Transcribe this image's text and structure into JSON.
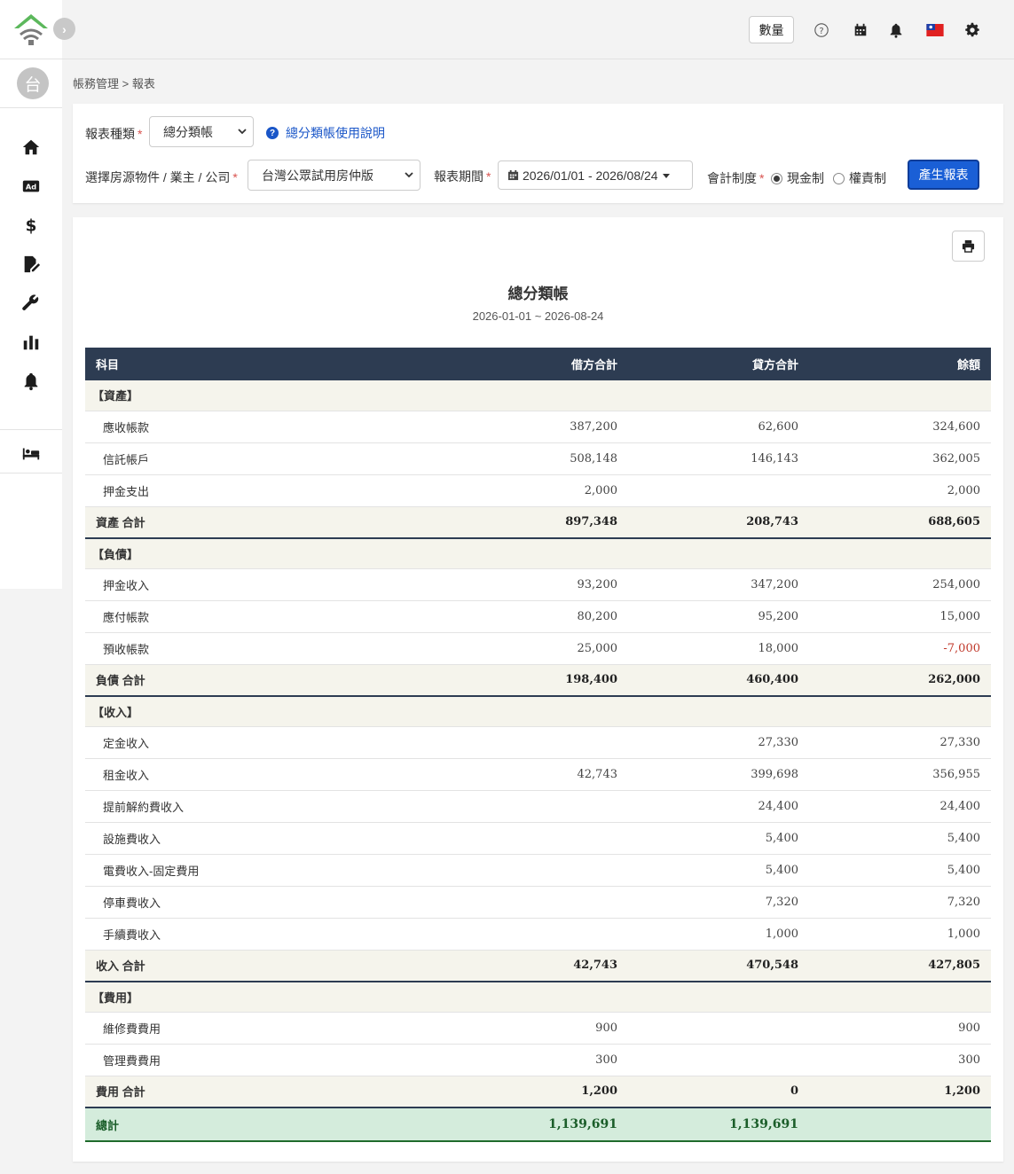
{
  "sidebar": {
    "avatar_text": "台"
  },
  "topbar": {
    "qty_label": "數量"
  },
  "breadcrumb": "帳務管理 > 報表",
  "filter": {
    "report_type_label": "報表種類",
    "report_type_value": "總分類帳",
    "help_link": "總分類帳使用說明",
    "property_label": "選擇房源物件 / 業主 / 公司",
    "property_value": "台灣公眾試用房仲版",
    "period_label": "報表期間",
    "period_value": "2026/01/01 - 2026/08/24",
    "accounting_label": "會計制度",
    "cash_label": "現金制",
    "accrual_label": "權責制",
    "generate_button": "產生報表"
  },
  "report": {
    "title": "總分類帳",
    "range": "2026-01-01 ~ 2026-08-24",
    "columns": [
      "科目",
      "借方合計",
      "貸方合計",
      "餘額"
    ],
    "sections": [
      {
        "name": "【資產】",
        "rows": [
          {
            "name": "應收帳款",
            "debit": "387,200",
            "credit": "62,600",
            "balance": "324,600"
          },
          {
            "name": "信託帳戶",
            "debit": "508,148",
            "credit": "146,143",
            "balance": "362,005"
          },
          {
            "name": "押金支出",
            "debit": "2,000",
            "credit": "",
            "balance": "2,000"
          }
        ],
        "total": {
          "name": "資產 合計",
          "debit": "897,348",
          "credit": "208,743",
          "balance": "688,605"
        }
      },
      {
        "name": "【負債】",
        "rows": [
          {
            "name": "押金收入",
            "debit": "93,200",
            "credit": "347,200",
            "balance": "254,000"
          },
          {
            "name": "應付帳款",
            "debit": "80,200",
            "credit": "95,200",
            "balance": "15,000"
          },
          {
            "name": "預收帳款",
            "debit": "25,000",
            "credit": "18,000",
            "balance": "-7,000"
          }
        ],
        "total": {
          "name": "負債 合計",
          "debit": "198,400",
          "credit": "460,400",
          "balance": "262,000"
        }
      },
      {
        "name": "【收入】",
        "rows": [
          {
            "name": "定金收入",
            "debit": "",
            "credit": "27,330",
            "balance": "27,330"
          },
          {
            "name": "租金收入",
            "debit": "42,743",
            "credit": "399,698",
            "balance": "356,955"
          },
          {
            "name": "提前解約費收入",
            "debit": "",
            "credit": "24,400",
            "balance": "24,400"
          },
          {
            "name": "設施費收入",
            "debit": "",
            "credit": "5,400",
            "balance": "5,400"
          },
          {
            "name": "電費收入-固定費用",
            "debit": "",
            "credit": "5,400",
            "balance": "5,400"
          },
          {
            "name": "停車費收入",
            "debit": "",
            "credit": "7,320",
            "balance": "7,320"
          },
          {
            "name": "手續費收入",
            "debit": "",
            "credit": "1,000",
            "balance": "1,000"
          }
        ],
        "total": {
          "name": "收入 合計",
          "debit": "42,743",
          "credit": "470,548",
          "balance": "427,805"
        }
      },
      {
        "name": "【費用】",
        "rows": [
          {
            "name": "維修費費用",
            "debit": "900",
            "credit": "",
            "balance": "900"
          },
          {
            "name": "管理費費用",
            "debit": "300",
            "credit": "",
            "balance": "300"
          }
        ],
        "total": {
          "name": "費用 合計",
          "debit": "1,200",
          "credit": "0",
          "balance": "1,200"
        }
      }
    ],
    "grand_total": {
      "name": "總計",
      "debit": "1,139,691",
      "credit": "1,139,691",
      "balance": ""
    }
  },
  "colors": {
    "header_bg": "#2d3c52",
    "primary": "#1a5fd6",
    "negative": "#c0392b",
    "grand_bg": "#d4ecdc"
  }
}
